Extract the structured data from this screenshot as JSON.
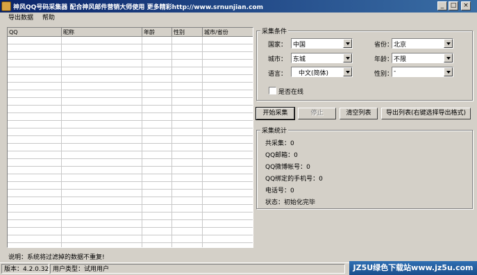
{
  "window": {
    "title": "神风QQ号码采集器 配合神风邮件营销大师使用 更多精彩http://www.srnunjian.com",
    "minimize_glyph": "_",
    "maximize_glyph": "□",
    "close_glyph": "×"
  },
  "menu": {
    "items": [
      "导出数据",
      "帮助"
    ]
  },
  "table": {
    "columns": [
      "QQ",
      "昵称",
      "年龄",
      "性别",
      "城市/省份"
    ]
  },
  "criteria": {
    "legend": "采集条件",
    "country_label": "国家：",
    "country_value": "中国",
    "province_label": "省份：",
    "province_value": "北京",
    "city_label": "城市：",
    "city_value": "东城",
    "age_label": "年龄：",
    "age_value": "不限",
    "language_label": "语言：",
    "language_value": "中文(简体)",
    "gender_label": "性别：",
    "gender_value": "-",
    "online_label": "是否在线"
  },
  "buttons": {
    "start": "开始采集",
    "stop": "停止",
    "clear": "清空列表",
    "export": "导出列表(右键选择导出格式)"
  },
  "stats": {
    "legend": "采集统计",
    "total": "共采集：0",
    "qq_mail": "QQ邮箱：0",
    "qq_weibo": "QQ微博帐号：0",
    "qq_phone": "QQ绑定的手机号：0",
    "phone": "电话号：0",
    "status": "状态：初始化完毕"
  },
  "hint": "说明：系统将过滤掉的数据不重复!",
  "statusbar": {
    "version": "版本：4.2.0.32",
    "user_type": "用户类型：试用用户"
  },
  "watermark": "JZ5U绿色下载站www.jz5u.com",
  "colors": {
    "titlebar_start": "#0a246a",
    "titlebar_end": "#3a6ea5",
    "face": "#d4d0c8"
  }
}
